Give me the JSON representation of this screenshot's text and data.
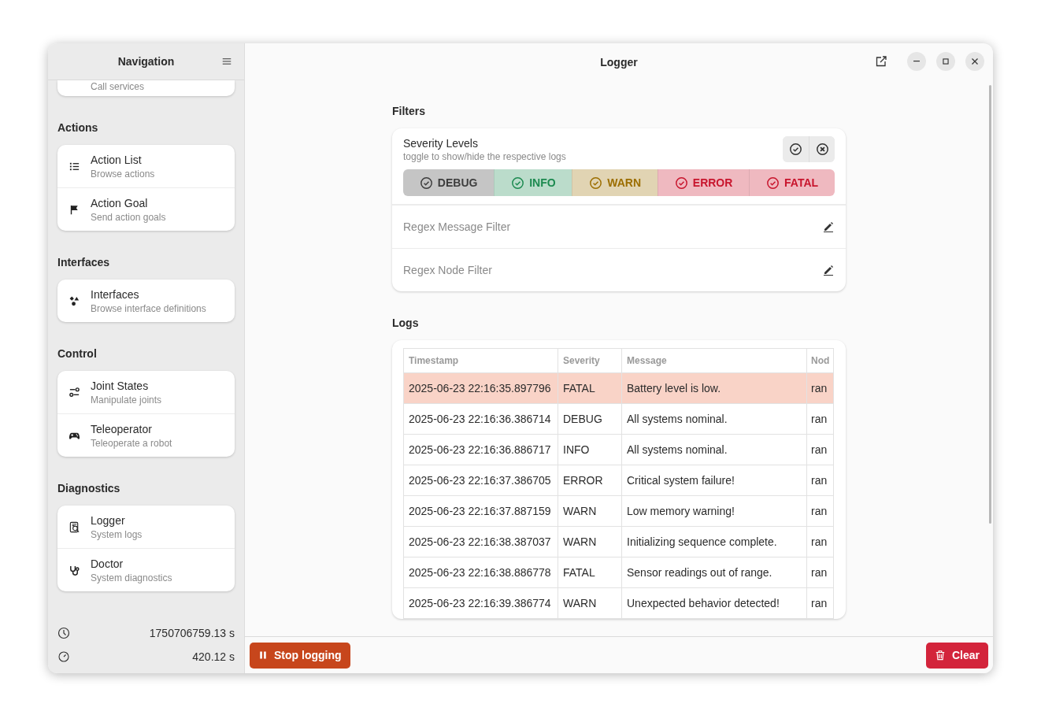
{
  "sidebar": {
    "title": "Navigation",
    "sections": [
      {
        "items": [
          {
            "subtitle": "Call services"
          }
        ]
      },
      {
        "title": "Actions",
        "items": [
          {
            "title": "Action List",
            "subtitle": "Browse actions"
          },
          {
            "title": "Action Goal",
            "subtitle": "Send action goals"
          }
        ]
      },
      {
        "title": "Interfaces",
        "items": [
          {
            "title": "Interfaces",
            "subtitle": "Browse interface definitions"
          }
        ]
      },
      {
        "title": "Control",
        "items": [
          {
            "title": "Joint States",
            "subtitle": "Manipulate joints"
          },
          {
            "title": "Teleoperator",
            "subtitle": "Teleoperate a robot"
          }
        ]
      },
      {
        "title": "Diagnostics",
        "items": [
          {
            "title": "Logger",
            "subtitle": "System logs"
          },
          {
            "title": "Doctor",
            "subtitle": "System diagnostics"
          }
        ]
      }
    ],
    "footer": [
      {
        "kind": "clock",
        "value": "1750706759.13 s"
      },
      {
        "kind": "timer",
        "value": "420.12 s"
      }
    ]
  },
  "window": {
    "title": "Logger"
  },
  "filters": {
    "heading": "Filters",
    "severity": {
      "title": "Severity Levels",
      "subtitle": "toggle to show/hide the respective logs",
      "levels": [
        {
          "label": "DEBUG",
          "on": true,
          "color": "#3d3d3d"
        },
        {
          "label": "INFO",
          "on": true,
          "color": "#1c8a50"
        },
        {
          "label": "WARN",
          "on": true,
          "color": "#9c6e00"
        },
        {
          "label": "ERROR",
          "on": true,
          "color": "#c8152d"
        },
        {
          "label": "FATAL",
          "on": true,
          "color": "#c8152d"
        }
      ]
    },
    "fields": [
      {
        "placeholder": "Regex Message Filter"
      },
      {
        "placeholder": "Regex Node Filter"
      }
    ]
  },
  "logs": {
    "heading": "Logs",
    "columns": [
      "Timestamp",
      "Severity",
      "Message",
      "Nod"
    ],
    "rows": [
      {
        "cells": [
          "2025-06-23 22:16:35.897796",
          "FATAL",
          "Battery level is low.",
          "ran"
        ],
        "selected": true
      },
      {
        "cells": [
          "2025-06-23 22:16:36.386714",
          "DEBUG",
          "All systems nominal.",
          "ran"
        ],
        "selected": false
      },
      {
        "cells": [
          "2025-06-23 22:16:36.886717",
          "INFO",
          "All systems nominal.",
          "ran"
        ],
        "selected": false
      },
      {
        "cells": [
          "2025-06-23 22:16:37.386705",
          "ERROR",
          "Critical system failure!",
          "ran"
        ],
        "selected": false
      },
      {
        "cells": [
          "2025-06-23 22:16:37.887159",
          "WARN",
          "Low memory warning!",
          "ran"
        ],
        "selected": false
      },
      {
        "cells": [
          "2025-06-23 22:16:38.387037",
          "WARN",
          "Initializing sequence complete.",
          "ran"
        ],
        "selected": false
      },
      {
        "cells": [
          "2025-06-23 22:16:38.886778",
          "FATAL",
          "Sensor readings out of range.",
          "ran"
        ],
        "selected": false
      },
      {
        "cells": [
          "2025-06-23 22:16:39.386774",
          "WARN",
          "Unexpected behavior detected!",
          "ran"
        ],
        "selected": false
      }
    ]
  },
  "bottom_bar": {
    "stop_button": "Stop logging",
    "clear_button": "Clear"
  }
}
